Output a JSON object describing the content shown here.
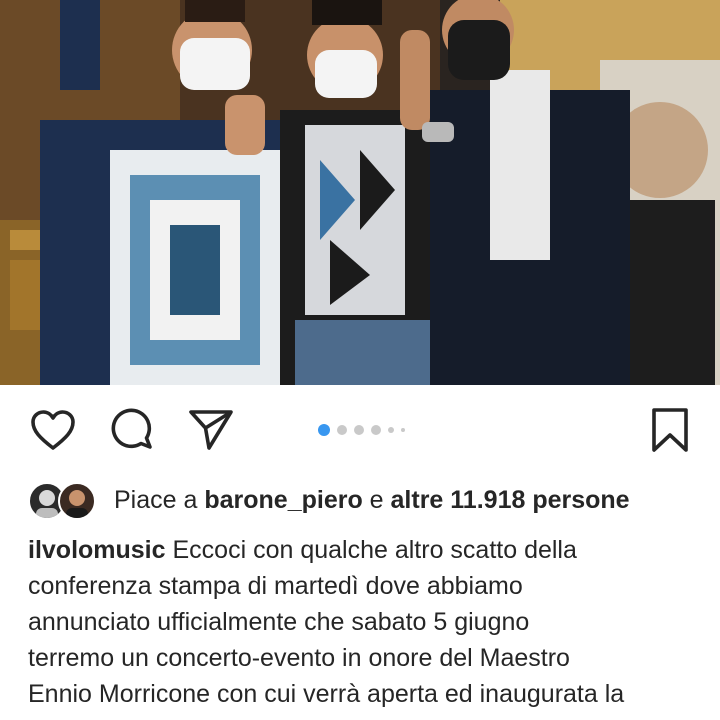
{
  "post": {
    "image_alt": "Three men in face masks posing for a selfie",
    "carousel": {
      "count": 6,
      "active_index": 0
    }
  },
  "actions": {
    "like_icon": "heart-icon",
    "comment_icon": "comment-icon",
    "share_icon": "send-icon",
    "save_icon": "bookmark-icon"
  },
  "likes": {
    "prefix": "Piace a",
    "user": "barone_piero",
    "middle": "e",
    "others": "altre 11.918 persone"
  },
  "caption": {
    "username": "ilvolomusic",
    "lines": [
      "Eccoci con qualche altro scatto della",
      "conferenza stampa di martedì dove abbiamo",
      "annunciato ufficialmente che sabato 5 giugno",
      "terremo un concerto-evento in onore del Maestro",
      "Ennio Morricone con cui verrà aperta ed inaugurata la"
    ]
  },
  "colors": {
    "accent": "#3897f0",
    "text": "#262626",
    "dot_inactive": "#c9c9c9"
  }
}
